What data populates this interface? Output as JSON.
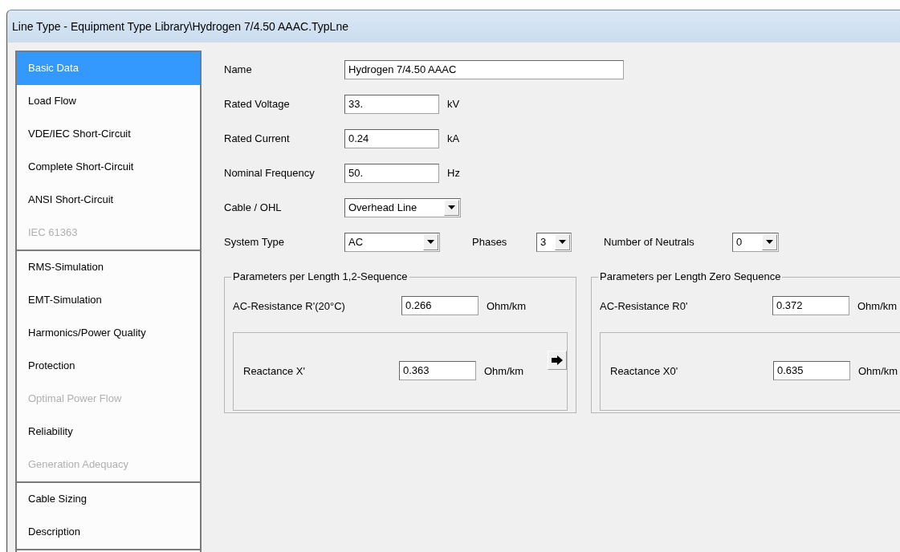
{
  "window": {
    "title": "Line Type - Equipment Type Library\\Hydrogen 7/4.50 AAAC.TypLne"
  },
  "sidebar": {
    "groups": [
      {
        "items": [
          {
            "label": "Basic Data",
            "selected": true,
            "disabled": false
          },
          {
            "label": "Load Flow",
            "selected": false,
            "disabled": false
          },
          {
            "label": "VDE/IEC Short-Circuit",
            "selected": false,
            "disabled": false
          },
          {
            "label": "Complete Short-Circuit",
            "selected": false,
            "disabled": false
          },
          {
            "label": "ANSI Short-Circuit",
            "selected": false,
            "disabled": false
          },
          {
            "label": "IEC 61363",
            "selected": false,
            "disabled": true
          }
        ]
      },
      {
        "items": [
          {
            "label": "RMS-Simulation",
            "selected": false,
            "disabled": false
          },
          {
            "label": "EMT-Simulation",
            "selected": false,
            "disabled": false
          },
          {
            "label": "Harmonics/Power Quality",
            "selected": false,
            "disabled": false
          },
          {
            "label": "Protection",
            "selected": false,
            "disabled": false
          },
          {
            "label": "Optimal Power Flow",
            "selected": false,
            "disabled": true
          },
          {
            "label": "Reliability",
            "selected": false,
            "disabled": false
          },
          {
            "label": "Generation Adequacy",
            "selected": false,
            "disabled": true
          }
        ]
      },
      {
        "items": [
          {
            "label": "Cable Sizing",
            "selected": false,
            "disabled": false
          },
          {
            "label": "Description",
            "selected": false,
            "disabled": false
          }
        ]
      }
    ]
  },
  "form": {
    "rows": [
      {
        "fields": [
          {
            "kind": "text",
            "label": "Name",
            "value": "Hydrogen 7/4.50 AAAC"
          }
        ]
      },
      {
        "fields": [
          {
            "kind": "text",
            "label": "Rated Voltage",
            "value": "33.",
            "unit": "kV"
          }
        ]
      },
      {
        "fields": [
          {
            "kind": "text",
            "label": "Rated Current",
            "value": "0.24",
            "unit": "kA"
          }
        ]
      },
      {
        "fields": [
          {
            "kind": "text",
            "label": "Nominal Frequency",
            "value": "50.",
            "unit": "Hz"
          }
        ]
      },
      {
        "fields": [
          {
            "kind": "select",
            "label": "Cable / OHL",
            "value": "Overhead Line"
          }
        ]
      },
      {
        "fields": [
          {
            "kind": "select",
            "label": "System Type",
            "value": "AC"
          },
          {
            "kind": "select",
            "label": "Phases",
            "value": "3"
          },
          {
            "kind": "select",
            "label": "Number of Neutrals",
            "value": "0"
          }
        ]
      }
    ]
  },
  "groups": [
    {
      "title": "Parameters per Length 1,2-Sequence",
      "resistance": {
        "label": "AC-Resistance R'(20°C)",
        "value": "0.266",
        "unit": "Ohm/km"
      },
      "reactance": {
        "label": "Reactance X'",
        "value": "0.363",
        "unit": "Ohm/km"
      },
      "arrow_button": true
    },
    {
      "title": "Parameters per Length Zero Sequence",
      "resistance": {
        "label": "AC-Resistance R0'",
        "value": "0.372",
        "unit": "Ohm/km"
      },
      "reactance": {
        "label": "Reactance X0'",
        "value": "0.635",
        "unit": "Ohm/km"
      },
      "arrow_button": false
    }
  ]
}
